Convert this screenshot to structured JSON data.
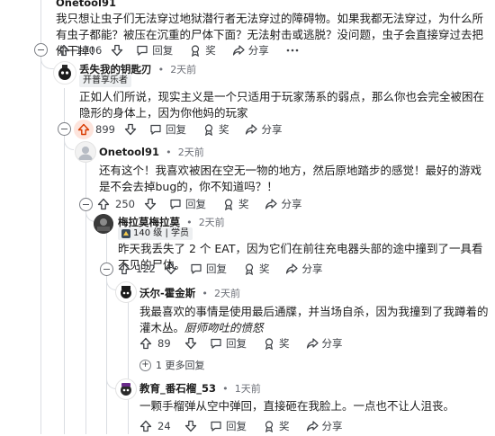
{
  "comments": [
    {
      "id": "c0",
      "username": "Onetool91",
      "body": "我只想让虫子们无法穿过地狱潜行者无法穿过的障碍物。如果我都无法穿过，为什么所有虫子都能？被压在沉重的尸体下面？无法射击或逃脱？没问题，虫子会直接穿过去把你干掉！",
      "votes": "1706",
      "reply": "回复",
      "award": "奖",
      "share": "分享"
    },
    {
      "id": "c1",
      "username": "丢失我的钥匙刃",
      "time": "2天前",
      "flair": "开普享乐者",
      "body": "正如人们所说，现实主义是一个只适用于玩家荡系的弱点，那么你也会完全被困在隐形的身体上，因为你他妈的玩家",
      "votes": "899",
      "reply": "回复",
      "award": "奖",
      "share": "分享"
    },
    {
      "id": "c2",
      "username": "Onetool91",
      "time": "2天前",
      "body": "还有这个！我喜欢被困在空无一物的地方，然后原地踏步的感觉！最好的游戏是不会去掉bug的，你不知道吗？！",
      "votes": "250",
      "reply": "回复",
      "award": "奖",
      "share": "分享"
    },
    {
      "id": "c3",
      "username": "梅拉莫梅拉莫",
      "time": "2天前",
      "flair": "140 级 | 学员",
      "body": "昨天我丢失了 2 个 EAT，因为它们在前往充电器头部的途中撞到了一具看不见的尸体。",
      "votes": "122",
      "reply": "回复",
      "award": "奖",
      "share": "分享"
    },
    {
      "id": "c4",
      "username": "沃尔-霍金斯",
      "time": "2天前",
      "body_plain": "我最喜欢的事情是使用最后通牒，并当场自杀，因为我撞到了我蹲着的灌木丛。",
      "body_italic": "厨师吻吐的愤怒",
      "votes": "89",
      "reply": "回复",
      "award": "奖",
      "share": "分享",
      "more_replies": "1 更多回复"
    },
    {
      "id": "c5",
      "username": "教育_番石榴_53",
      "time": "1天前",
      "body": "一颗手榴弹从空中弹回，直接砸在我脸上。一点也不让人沮丧。",
      "votes": "24",
      "reply": "回复",
      "award": "奖",
      "share": "分享"
    }
  ],
  "separator": "•",
  "colors": {
    "upvote_active": "#d93a00",
    "upvote_active_bg": "#fde4dc",
    "thread_line": "#dadde2",
    "meta_text": "#6e7179"
  }
}
